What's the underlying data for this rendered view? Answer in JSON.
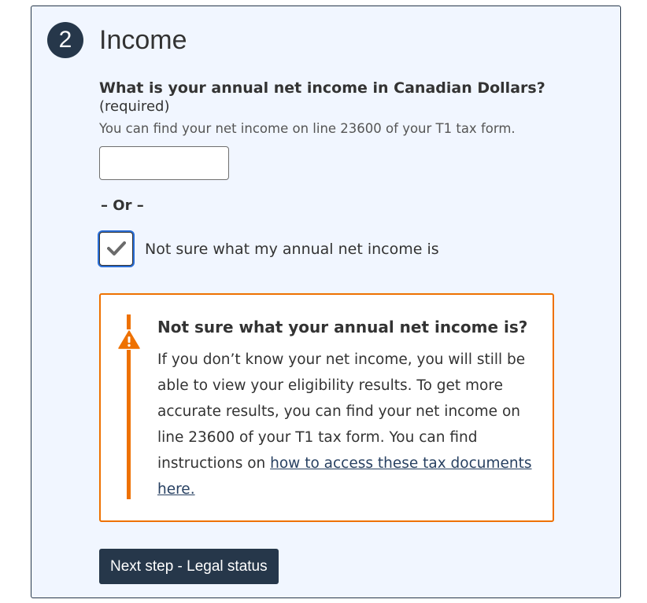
{
  "section": {
    "step_number": "2",
    "title": "Income"
  },
  "income_question": {
    "label": "What is your annual net income in Canadian Dollars?",
    "required_text": "(required)",
    "hint": "You can find your net income on line 23600 of your T1 tax form.",
    "input_value": "",
    "input_placeholder": ""
  },
  "or_separator": "– Or –",
  "not_sure_checkbox": {
    "label": "Not sure what my annual net income is",
    "checked": true
  },
  "alert": {
    "type": "warning",
    "color": "#ee7100",
    "icon": "warning-triangle-icon",
    "title": "Not sure what your annual net income is?",
    "body_text": "If you don’t know your net income, you will still be able to view your eligibility results. To get more accurate results, you can find your net income on line 23600 of your T1 tax form. You can find instructions on ",
    "link_text": "how to access these tax documents here."
  },
  "next_button": {
    "label": "Next step - Legal status"
  },
  "colors": {
    "panel_background": "#f1f6ff",
    "primary_dark": "#26374a",
    "warning": "#ee7100",
    "link": "#284162"
  }
}
